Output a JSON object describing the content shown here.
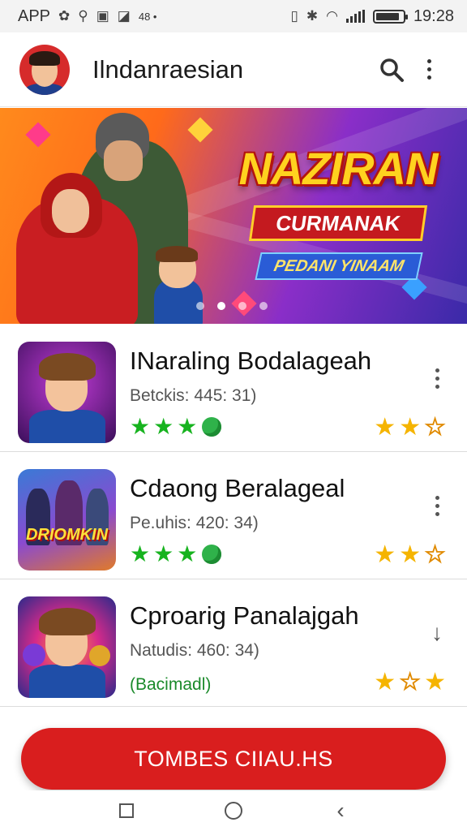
{
  "status_bar": {
    "left_text": "APP",
    "small_text": "48 •",
    "time": "19:28"
  },
  "header": {
    "title": "Ilndanraesian"
  },
  "banner": {
    "title": "NAZIRAN",
    "ribbon": "CURMANAK",
    "subtitle": "PEDANI YINAAM",
    "slide_count": 4,
    "active_slide": 1
  },
  "games": [
    {
      "title": "INaraling Bodalageah",
      "meta": "Betckis: 445: 31)",
      "green_rating": "3 stars + badge",
      "action": "more",
      "yellow_stars": 3
    },
    {
      "title": "Cdaong Beralageal",
      "meta": "Pe.uhis: 420: 34)",
      "thumb_text": "DRIOMKIN",
      "action": "more",
      "yellow_stars": 3
    },
    {
      "title": "Cproarig Panalajgah",
      "meta": "Natudis: 460: 34)",
      "badge": "(Bacimadl)",
      "action": "download",
      "yellow_stars": 3
    }
  ],
  "cta": {
    "label": "TOMBES CIIAU.HS"
  },
  "colors": {
    "accent_red": "#d91e1e",
    "green": "#17b31f",
    "star_yellow": "#f5b400"
  }
}
